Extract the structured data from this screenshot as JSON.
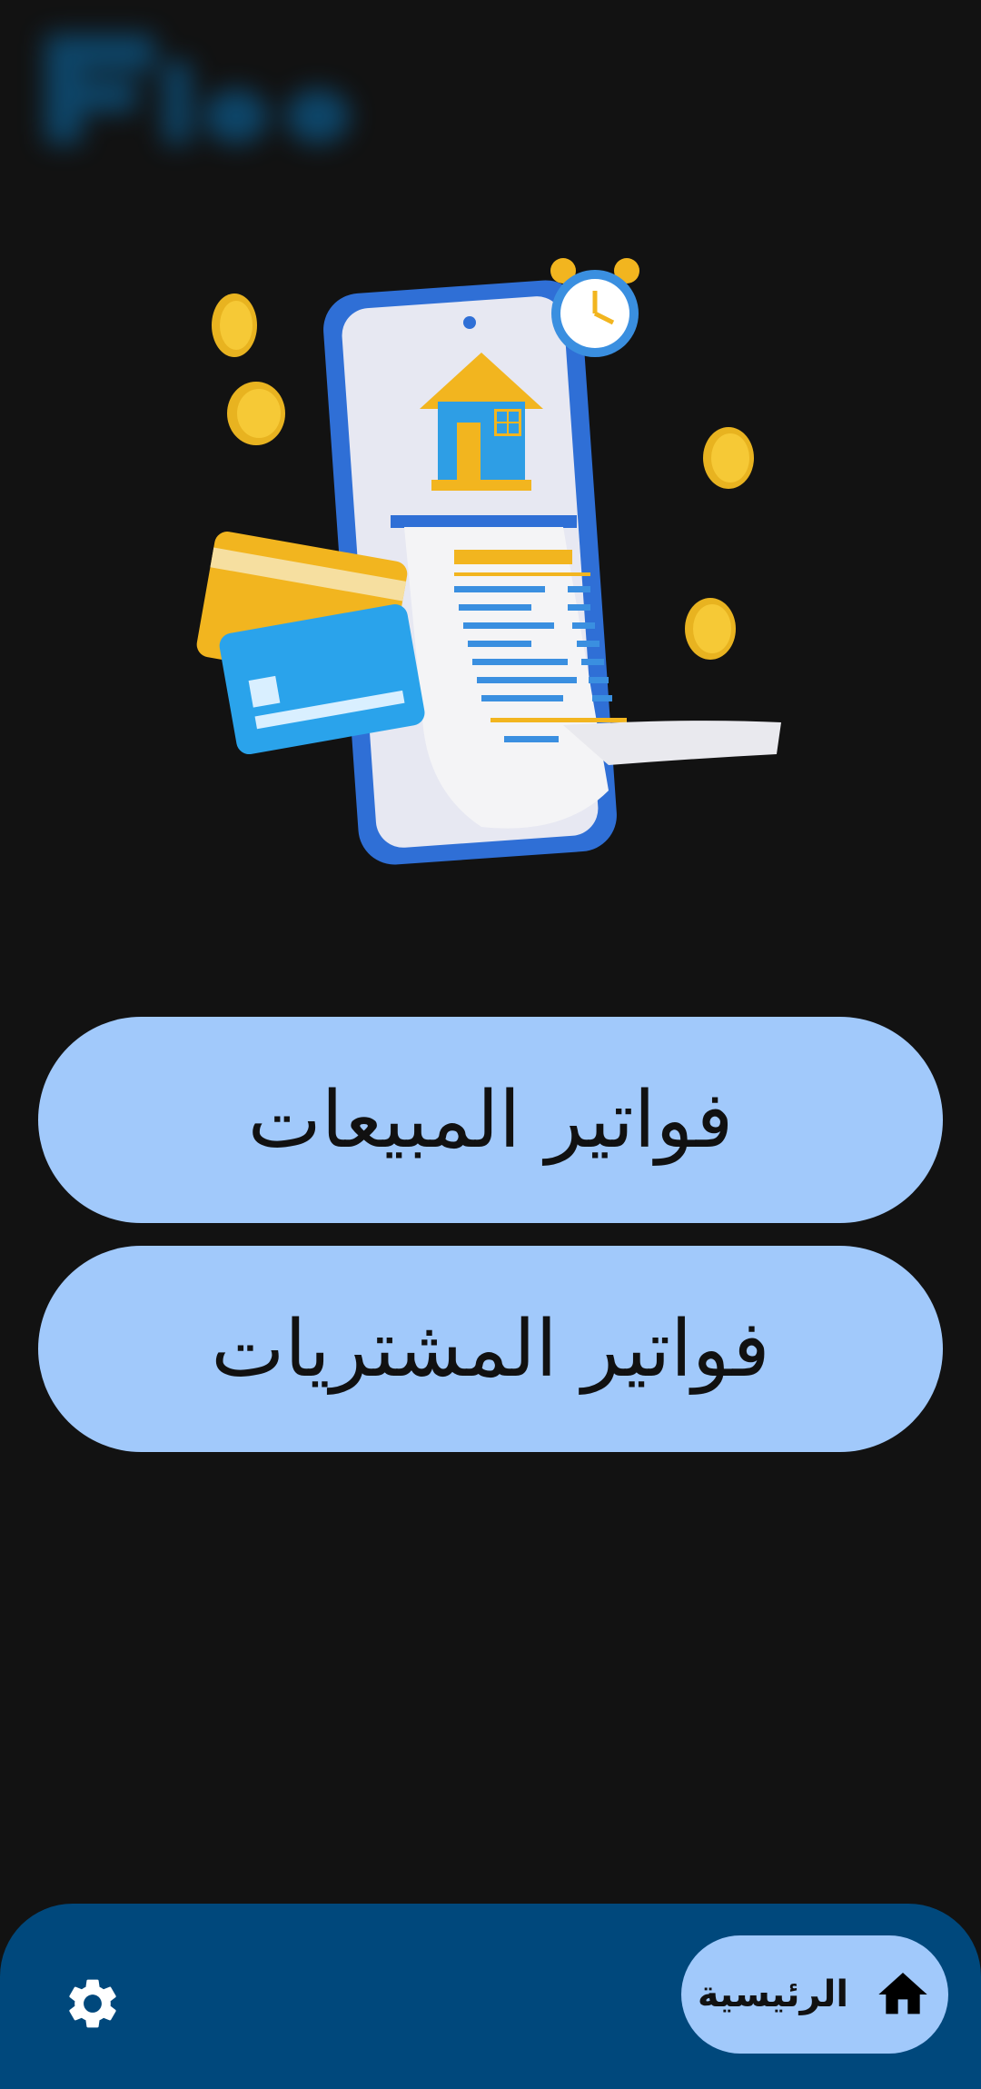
{
  "main": {
    "sales_invoices_label": "فواتير المبيعات",
    "purchase_invoices_label": "فواتير المشتريات"
  },
  "bottom_nav": {
    "home_label": "الرئيسية",
    "home_icon": "home-icon",
    "settings_icon": "settings-gear-icon"
  },
  "colors": {
    "background": "#121212",
    "button_fill": "#a1c9fb",
    "nav_bar": "#00487c"
  }
}
